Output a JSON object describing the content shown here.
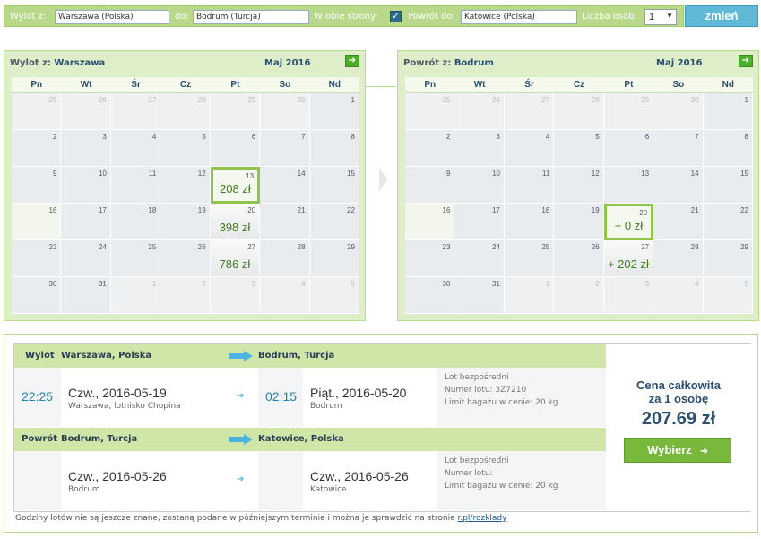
{
  "search": {
    "from_label": "Wylot z:",
    "from_value": "Warszawa (Polska)",
    "to_label": "do:",
    "to_value": "Bodrum (Turcja)",
    "roundtrip_label": "W obie strony:",
    "roundtrip_check": "✓",
    "return_label": "Powrót do:",
    "return_value": "Katowice (Polska)",
    "persons_label": "Liczba osób:",
    "persons_value": "1",
    "submit_label": "zmień"
  },
  "outbound_calendar": {
    "title_prefix": "Wylot z:",
    "city": "Warszawa",
    "month": "Maj 2016",
    "next": "➔"
  },
  "return_calendar": {
    "title_prefix": "Powrót z:",
    "city": "Bodrum",
    "month": "Maj 2016",
    "next": "➔"
  },
  "weekdays": [
    "Pn",
    "Wt",
    "Śr",
    "Cz",
    "Pt",
    "So",
    "Nd"
  ],
  "days": [
    "25",
    "26",
    "27",
    "28",
    "29",
    "30",
    "1",
    "2",
    "3",
    "4",
    "5",
    "6",
    "7",
    "8",
    "9",
    "10",
    "11",
    "12",
    "13",
    "14",
    "15",
    "16",
    "17",
    "18",
    "19",
    "20",
    "21",
    "22",
    "23",
    "24",
    "25",
    "26",
    "27",
    "28",
    "29",
    "30",
    "31",
    "1",
    "2",
    "3",
    "4",
    "5"
  ],
  "outbound_prices": {
    "18": "208 zł",
    "25": "398 zł",
    "32": "786 zł"
  },
  "return_prices": {
    "25": "+ 0 zł",
    "32": "+ 202 zł"
  },
  "summary": {
    "out_label": "Wylot",
    "out_from": "Warszawa, Polska",
    "out_to": "Bodrum, Turcja",
    "out_dep_time": "22:25",
    "out_dep_date": "Czw., 2016-05-19",
    "out_dep_place": "Warszawa, lotnisko Chopina",
    "out_arr_time": "02:15",
    "out_arr_date": "Piąt., 2016-05-20",
    "out_arr_place": "Bodrum",
    "out_info1": "Lot bezpośredni",
    "out_info2": "Numer lotu:  3Z7210",
    "out_info3": "Limit bagażu w cenie: 20 kg",
    "ret_label": "Powrót",
    "ret_from": "Bodrum, Turcja",
    "ret_to": "Katowice, Polska",
    "ret_dep_date": "Czw., 2016-05-26",
    "ret_dep_place": "Bodrum",
    "ret_arr_date": "Czw., 2016-05-26",
    "ret_arr_place": "Katowice",
    "ret_info1": "Lot bezpośredni",
    "ret_info2": "Numer lotu:",
    "ret_info3": "Limit bagażu w cenie: 20 kg",
    "total_label_1": "Cena całkowita",
    "total_label_2": "za 1 osobę",
    "total_value": "207.69 zł",
    "select_label": "Wybierz",
    "select_arrow": "➔"
  },
  "footnote": {
    "text": "Godziny lotów nie są jeszcze znane, zostaną podane w późniejszym terminie i można je sprawdzić na stronie ",
    "link": "r.pl/rozklady"
  }
}
